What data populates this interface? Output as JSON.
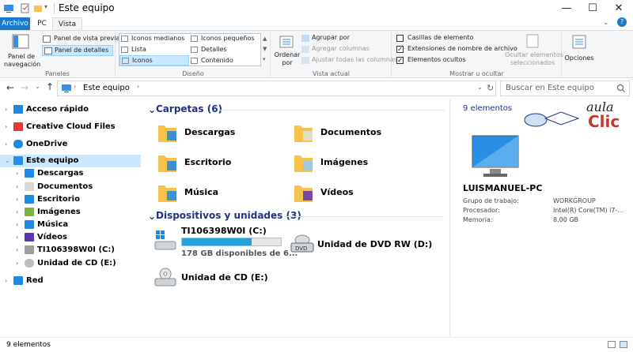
{
  "window": {
    "title": "Este equipo",
    "minimize": "—",
    "maximize": "☐",
    "close": "✕"
  },
  "ribbon_tabs": [
    "Archivo",
    "PC",
    "Vista"
  ],
  "ribbon": {
    "paneles": {
      "label": "Paneles",
      "nav_pane": "Panel de\nnavegación",
      "preview": "Panel de vista previa",
      "details": "Panel de detalles"
    },
    "diseno": {
      "label": "Diseño",
      "items": [
        "Iconos medianos",
        "Iconos pequeños",
        "Lista",
        "Detalles",
        "Iconos",
        "Contenido"
      ]
    },
    "vista_actual": {
      "label": "Vista actual",
      "ordenar": "Ordenar\npor",
      "agrupar": "Agrupar por",
      "agregar": "Agregar columnas",
      "ajustar": "Ajustar todas las columnas"
    },
    "mostrar": {
      "label": "Mostrar u ocultar",
      "casillas": "Casillas de elemento",
      "extensiones": "Extensiones de nombre de archivo",
      "ocultos": "Elementos ocultos",
      "ocultar_sel": "Ocultar elementos\nseleccionados"
    },
    "opciones": "Opciones"
  },
  "address": {
    "path": "Este equipo",
    "search_placeholder": "Buscar en Este equipo"
  },
  "nav": [
    {
      "label": "Acceso rápido",
      "icon": "star-icon"
    },
    {
      "label": "Creative Cloud Files",
      "icon": "creative-cloud-icon"
    },
    {
      "label": "OneDrive",
      "icon": "cloud-icon"
    },
    {
      "label": "Este equipo",
      "icon": "computer-icon",
      "selected": true
    },
    {
      "label": "Descargas",
      "icon": "download-icon"
    },
    {
      "label": "Documentos",
      "icon": "document-icon"
    },
    {
      "label": "Escritorio",
      "icon": "desktop-icon"
    },
    {
      "label": "Imágenes",
      "icon": "image-icon"
    },
    {
      "label": "Música",
      "icon": "music-icon"
    },
    {
      "label": "Vídeos",
      "icon": "video-icon"
    },
    {
      "label": "TI106398W0I (C:)",
      "icon": "drive-icon"
    },
    {
      "label": "Unidad de CD (E:)",
      "icon": "cd-icon"
    },
    {
      "label": "Red",
      "icon": "network-icon"
    }
  ],
  "folders_header": "Carpetas (6)",
  "folders": [
    "Descargas",
    "Documentos",
    "Escritorio",
    "Imágenes",
    "Música",
    "Vídeos"
  ],
  "devices_header": "Dispositivos y unidades (3)",
  "devices": {
    "c_drive": {
      "label": "TI106398W0I (C:)",
      "free": "178 GB disponibles de 6...",
      "used_fraction": 0.7
    },
    "dvd": {
      "label": "Unidad de DVD RW (D:)"
    },
    "cd": {
      "label": "Unidad de CD (E:)"
    }
  },
  "details": {
    "count": "9 elementos",
    "logo_top": "aula",
    "logo_bottom": "Clic",
    "pc_name": "LUISMANUEL-PC",
    "rows": [
      {
        "k": "Grupo de trabajo:",
        "v": "WORKGROUP"
      },
      {
        "k": "Procesador:",
        "v": "Intel(R) Core(TM) i7-..."
      },
      {
        "k": "Memoria:",
        "v": "8.00 GB"
      }
    ]
  },
  "status": "9 elementos",
  "colors": {
    "accent": "#1979ca",
    "header_blue": "#1e3287",
    "folder_yellow": "#f5c34b",
    "selected_bg": "#cce8ff",
    "logo_red": "#c0392b"
  }
}
